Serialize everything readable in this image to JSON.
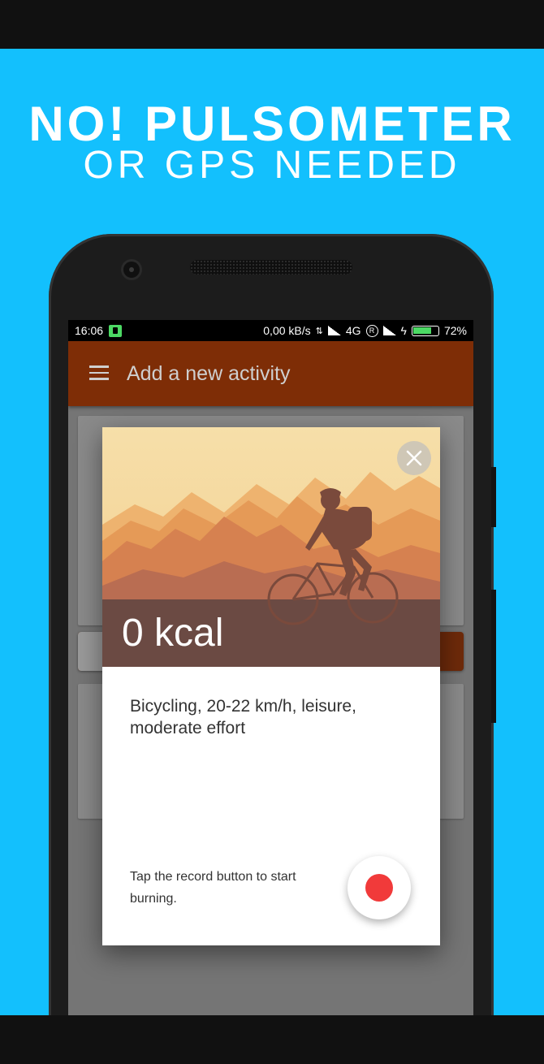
{
  "promo": {
    "headline_line1": "NO! PULSOMETER",
    "headline_line2": "OR GPS NEEDED",
    "background_color": "#13C0FD"
  },
  "status_bar": {
    "time": "16:06",
    "network_speed": "0,00 kB/s",
    "network_type": "4G",
    "battery": "72%"
  },
  "app_bar": {
    "menu_icon": "hamburger-menu-icon",
    "title": "Add a new activity",
    "color": "#7E2D06"
  },
  "dialog": {
    "close_icon": "close-icon",
    "hero_image": "cyclist-mountains-illustration",
    "kcal": "0 kcal",
    "activity_name": "Bicycling, 20-22 km/h, leisure, moderate effort",
    "hint": "Tap the record button to start burning.",
    "record_icon": "record-icon",
    "record_color": "#F13A3A"
  }
}
